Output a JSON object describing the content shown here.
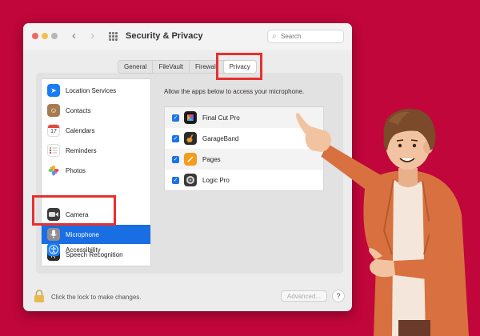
{
  "window": {
    "title": "Security & Privacy",
    "search_placeholder": "Search",
    "nav_back": "‹",
    "nav_forward": "›"
  },
  "tabs": [
    {
      "label": "General"
    },
    {
      "label": "FileVault"
    },
    {
      "label": "Firewall"
    },
    {
      "label": "Privacy",
      "active": true
    }
  ],
  "sidebar": {
    "selected": "Microphone",
    "items": [
      {
        "label": "Location Services",
        "icon": "location-arrow-icon",
        "color": "#1a7cf5"
      },
      {
        "label": "Contacts",
        "icon": "contacts-icon",
        "color": "#a77b4f"
      },
      {
        "label": "Calendars",
        "icon": "calendar-icon",
        "color": "#e9473d"
      },
      {
        "label": "Reminders",
        "icon": "reminders-icon",
        "color": "#f2f2f2"
      },
      {
        "label": "Photos",
        "icon": "photos-icon",
        "color": "#f2f2f2"
      },
      {
        "label": "Camera",
        "icon": "camera-icon",
        "color": "#3a3a3a"
      },
      {
        "label": "Microphone",
        "icon": "microphone-icon",
        "color": "#8e8e93"
      },
      {
        "label": "Speech Recognition",
        "icon": "waveform-icon",
        "color": "#2b2b2b"
      },
      {
        "label": "Accessibility",
        "icon": "accessibility-icon",
        "color": "#1a7cf5"
      }
    ],
    "calendar_day": "17"
  },
  "content": {
    "instruction": "Allow the apps below to access your microphone.",
    "apps": [
      {
        "name": "Final Cut Pro",
        "checked": true,
        "icon": "final-cut-pro-icon",
        "color": "#222"
      },
      {
        "name": "GarageBand",
        "checked": true,
        "icon": "garageband-icon",
        "color": "#2b2b2b"
      },
      {
        "name": "Pages",
        "checked": true,
        "icon": "pages-icon",
        "color": "#f59b1d"
      },
      {
        "name": "Logic Pro",
        "checked": true,
        "icon": "logic-pro-icon",
        "color": "#3a3a3a"
      }
    ]
  },
  "footer": {
    "lock_text": "Click the lock to make changes.",
    "advanced_label": "Advanced...",
    "help_label": "?"
  },
  "colors": {
    "background": "#c0063a",
    "highlight": "#e8302f",
    "selection": "#1a6ee3",
    "checkbox": "#1a73e8"
  }
}
